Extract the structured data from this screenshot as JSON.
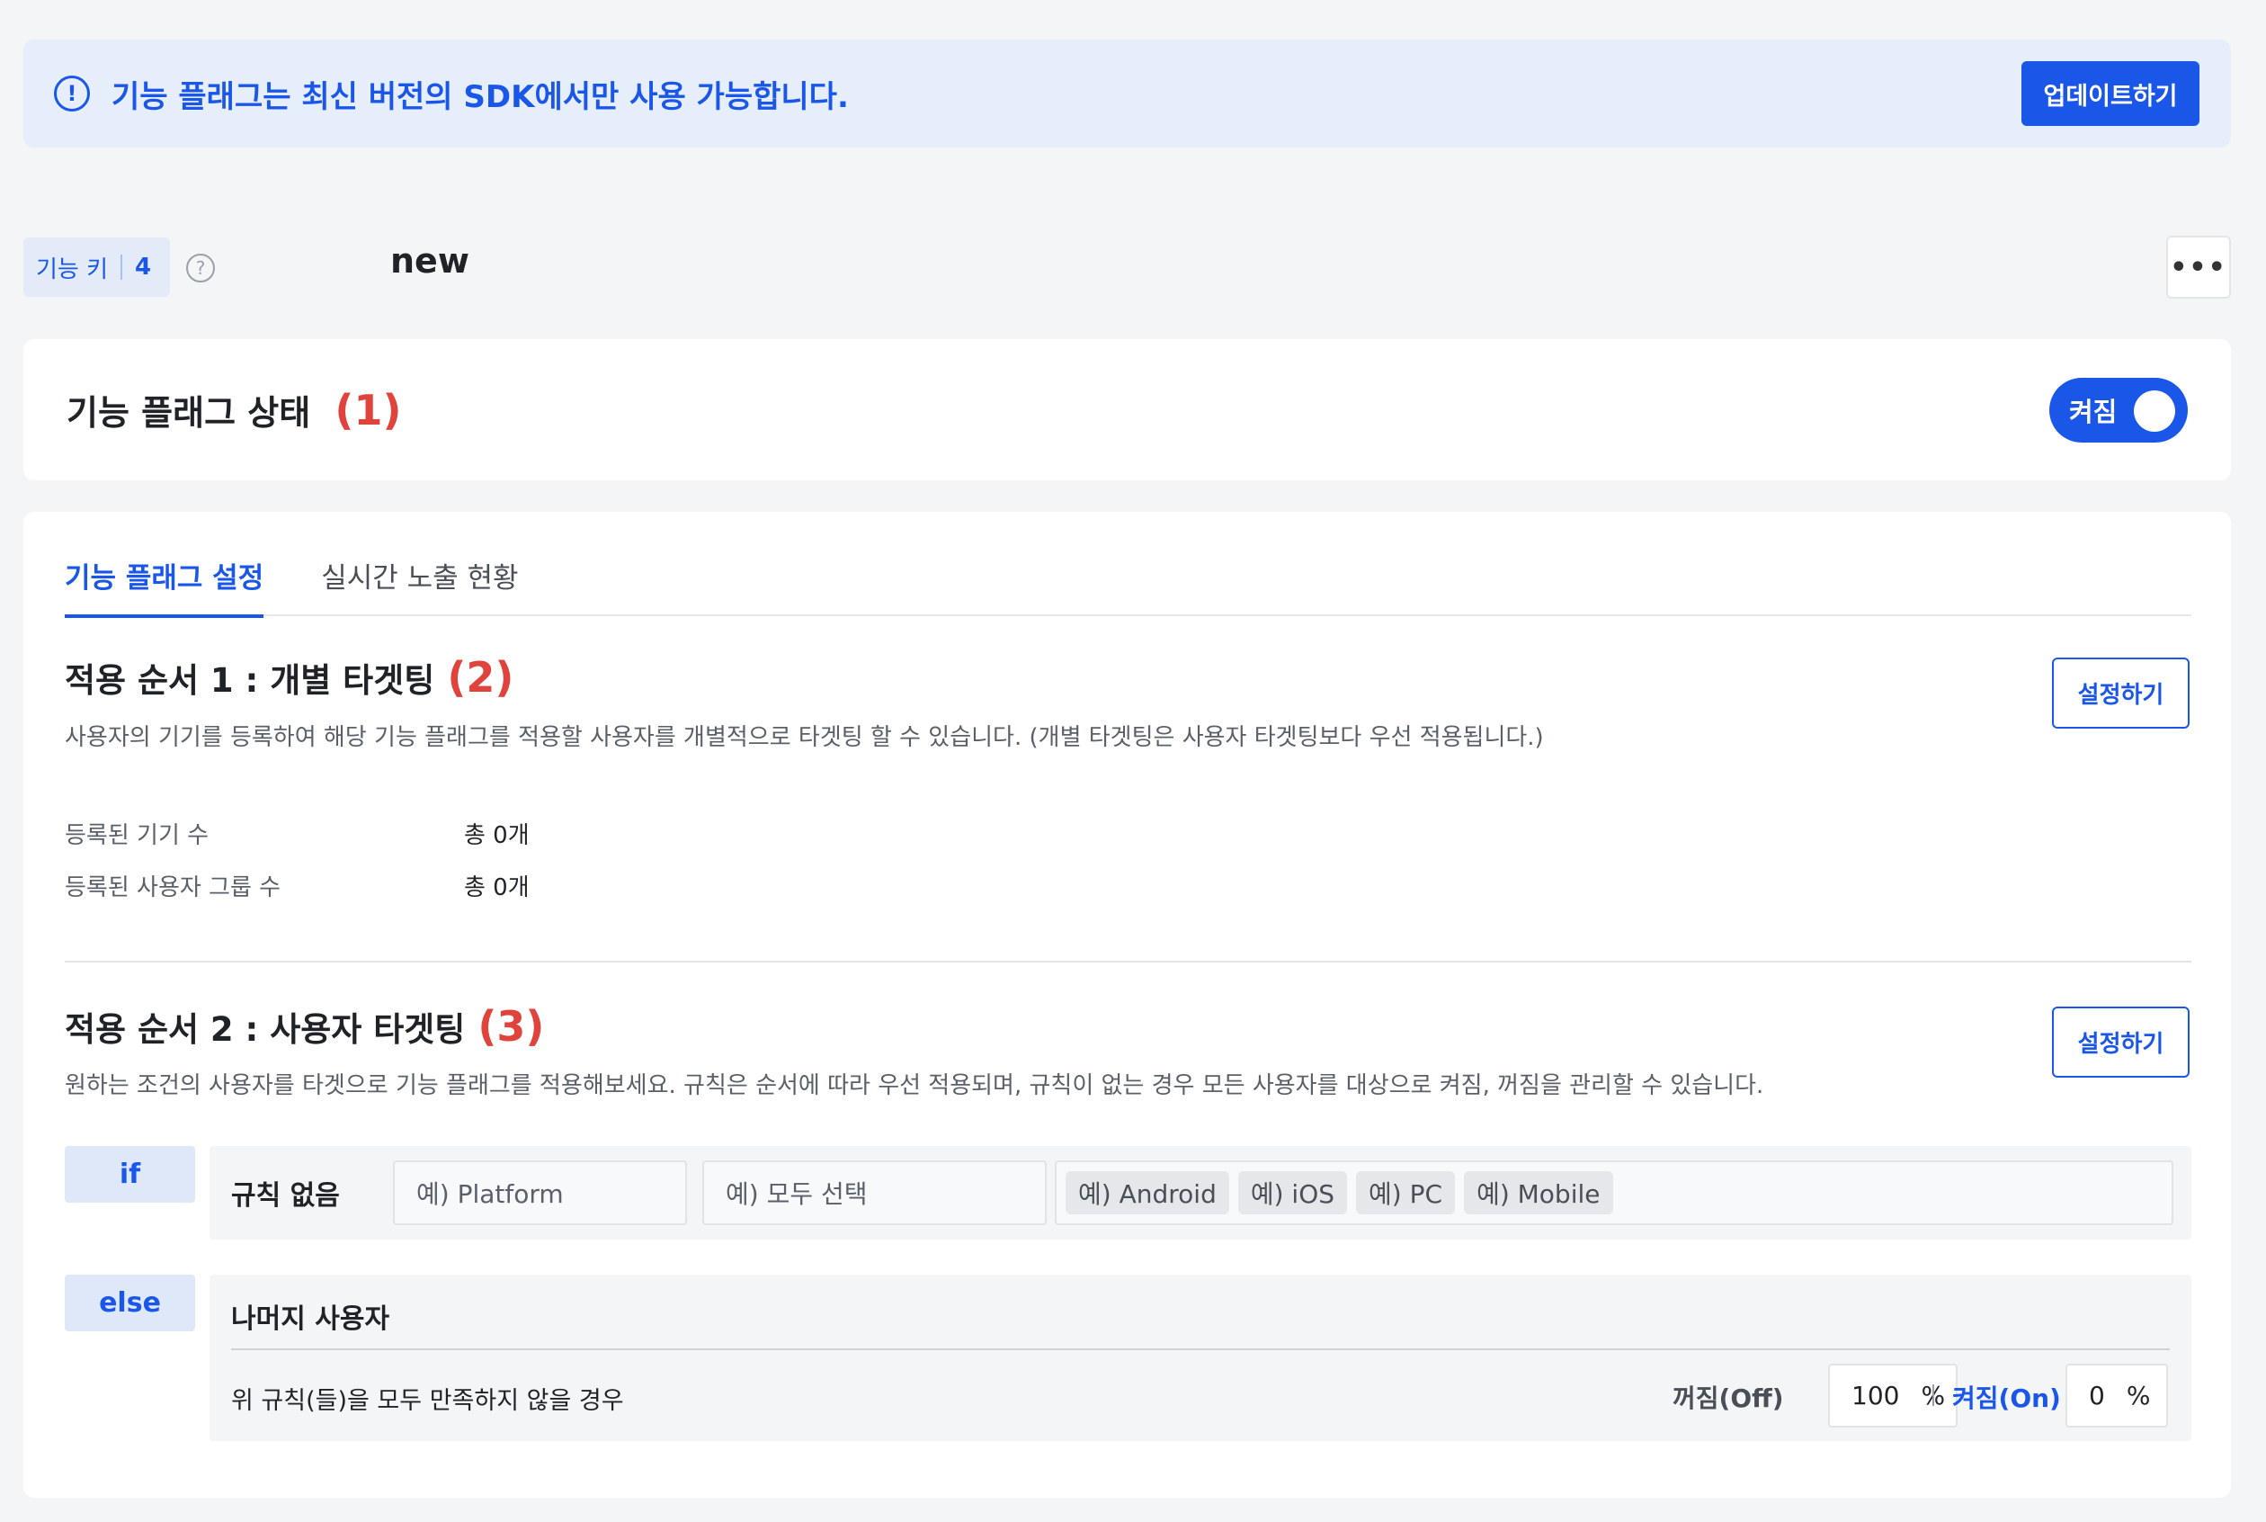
{
  "banner": {
    "message": "기능 플래그는 최신 버전의 SDK에서만 사용 가능합니다.",
    "icon": "alert-circle-icon",
    "update_label": "업데이트하기"
  },
  "feature_key": {
    "label": "기능 키",
    "count": "4",
    "help_icon": "?",
    "value": "new",
    "more_icon": "•••"
  },
  "status": {
    "title": "기능 플래그 상태",
    "annotation": "(1)",
    "toggle_label": "켜짐",
    "toggle_on": true
  },
  "tabs": [
    {
      "label": "기능 플래그 설정",
      "active": true
    },
    {
      "label": "실시간 노출 현황",
      "active": false
    }
  ],
  "section1": {
    "title": "적용 순서 1 : 개별 타겟팅",
    "annotation": "(2)",
    "description": "사용자의 기기를 등록하여 해당 기능 플래그를 적용할 사용자를 개별적으로 타겟팅 할 수 있습니다. (개별 타겟팅은 사용자 타겟팅보다 우선 적용됩니다.)",
    "button_label": "설정하기",
    "stats": [
      {
        "label": "등록된 기기 수",
        "value": "총 0개"
      },
      {
        "label": "등록된 사용자 그룹 수",
        "value": "총 0개"
      }
    ]
  },
  "section2": {
    "title": "적용 순서 2 : 사용자 타겟팅",
    "annotation": "(3)",
    "description": "원하는 조건의 사용자를 타겟으로 기능 플래그를 적용해보세요. 규칙은 순서에 따라 우선 적용되며, 규칙이 없는 경우 모든 사용자를 대상으로 켜짐, 꺼짐을 관리할 수 있습니다.",
    "button_label": "설정하기",
    "if_rule": {
      "tag": "if",
      "label": "규칙 없음",
      "field1_placeholder": "예) Platform",
      "field2_placeholder": "예) 모두 선택",
      "chips": [
        "예) Android",
        "예) iOS",
        "예) PC",
        "예) Mobile"
      ]
    },
    "else_rule": {
      "tag": "else",
      "title": "나머지 사용자",
      "description": "위 규칙(들)을 모두 만족하지 않을 경우",
      "off_label": "꺼짐(Off)",
      "off_value": "100",
      "on_label": "켜짐(On)",
      "on_value": "0",
      "unit": "%"
    }
  },
  "colors": {
    "primary": "#1a56e8",
    "annotation": "#e0433b",
    "banner_bg": "#e6eefb",
    "page_bg": "#f4f5f7"
  }
}
